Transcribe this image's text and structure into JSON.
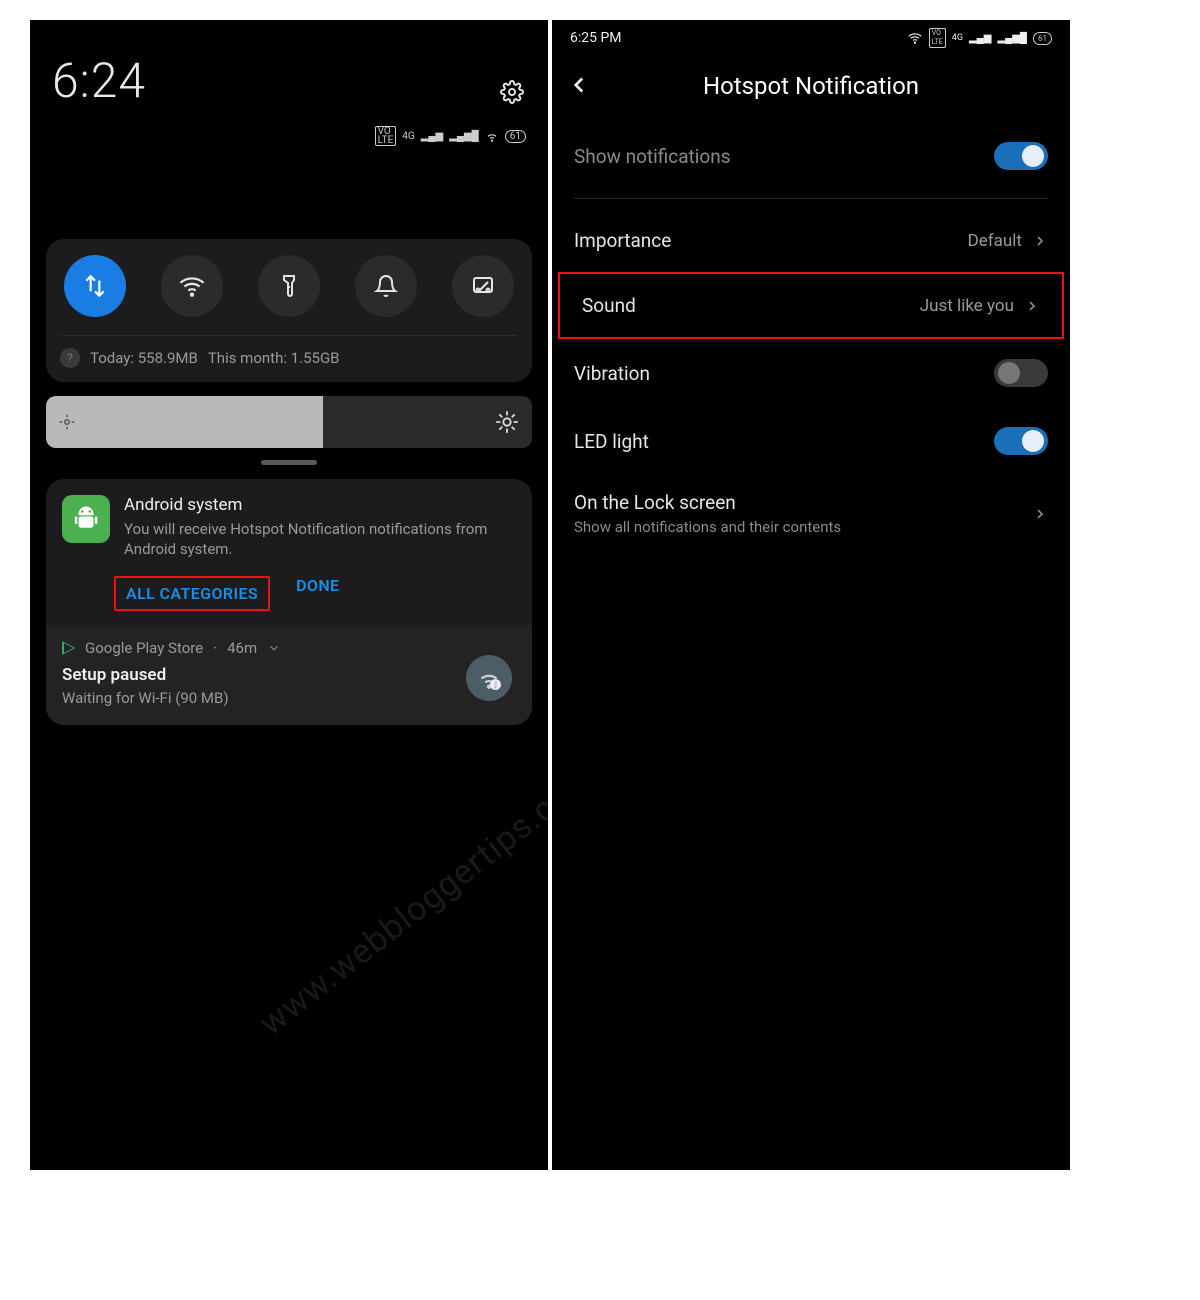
{
  "watermark": "www.webbloggertips.com",
  "left": {
    "clock": "6:24",
    "status": {
      "volte": "VO\nLTE",
      "net": "4G",
      "battery": "61"
    },
    "qs_data": {
      "today_label": "Today: 558.9MB",
      "month_label": "This month: 1.55GB"
    },
    "notif": {
      "app": "Android system",
      "body": "You will receive Hotspot Notification notifications from Android system.",
      "all_categories": "ALL CATEGORIES",
      "done": "DONE"
    },
    "gps": {
      "header": "Google Play Store",
      "age": "46m",
      "title": "Setup paused",
      "sub": "Waiting for Wi-Fi (90 MB)"
    }
  },
  "right": {
    "clock": "6:25 PM",
    "battery": "61",
    "title": "Hotspot Notification",
    "show_notifications": "Show notifications",
    "importance": {
      "label": "Importance",
      "value": "Default"
    },
    "sound": {
      "label": "Sound",
      "value": "Just like you"
    },
    "vibration": "Vibration",
    "led": "LED light",
    "lock": {
      "title": "On the Lock screen",
      "sub": "Show all notifications and their contents"
    }
  }
}
